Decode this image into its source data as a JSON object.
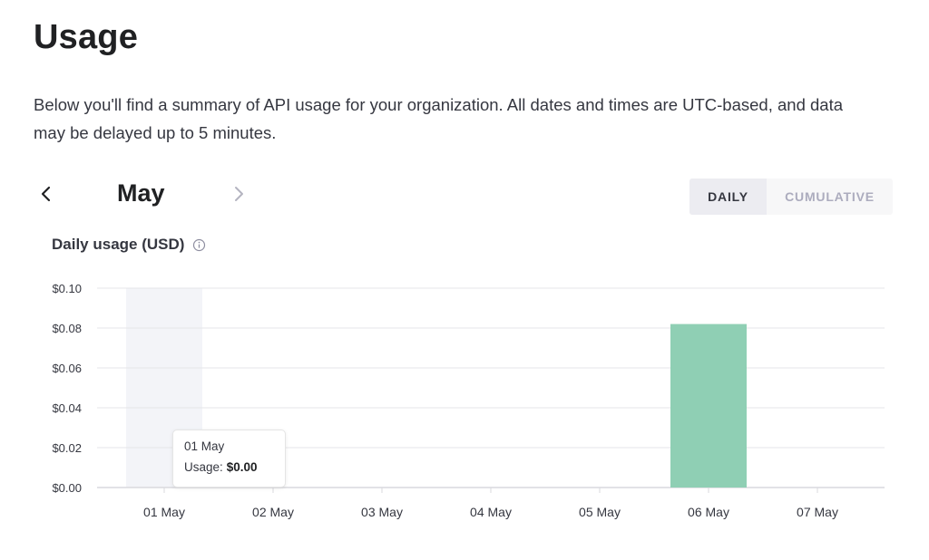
{
  "page": {
    "title": "Usage",
    "description": "Below you'll find a summary of API usage for your organization. All dates and times are UTC-based, and data may be delayed up to 5 minutes."
  },
  "month_nav": {
    "month": "May",
    "prev_icon": "chevron-left-icon",
    "next_icon": "chevron-right-icon"
  },
  "view_toggle": {
    "daily": "DAILY",
    "cumulative": "CUMULATIVE",
    "selected": "DAILY"
  },
  "chart_title": "Daily usage (USD)",
  "tooltip": {
    "date": "01 May",
    "label": "Usage:",
    "value": "$0.00"
  },
  "colors": {
    "bar": "#8fcfb4",
    "hover_band": "#f3f4f8",
    "grid": "#e6e6e9",
    "text": "#353740"
  },
  "chart_data": {
    "type": "bar",
    "title": "Daily usage (USD)",
    "categories": [
      "01 May",
      "02 May",
      "03 May",
      "04 May",
      "05 May",
      "06 May",
      "07 May"
    ],
    "values": [
      0,
      0,
      0,
      0,
      0,
      0.082,
      0
    ],
    "ylim": [
      0,
      0.1
    ],
    "y_ticks": [
      "$0.00",
      "$0.02",
      "$0.04",
      "$0.06",
      "$0.08",
      "$0.10"
    ],
    "y_tick_values": [
      0,
      0.02,
      0.04,
      0.06,
      0.08,
      0.1
    ],
    "grid": true,
    "hovered_category": "01 May"
  }
}
